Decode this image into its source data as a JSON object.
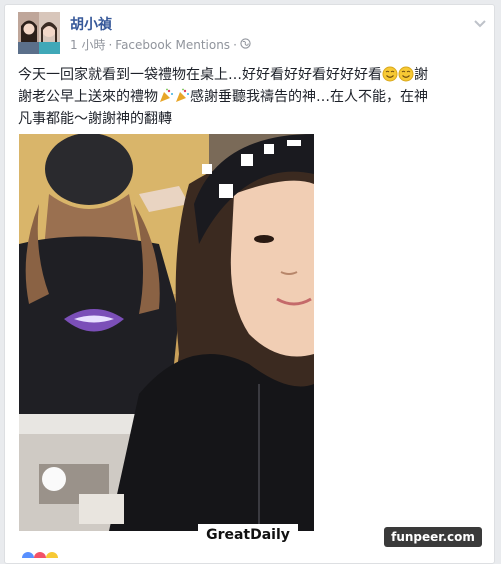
{
  "post": {
    "author": "胡小禎",
    "time": "1 小時",
    "separator": " · ",
    "app": "Facebook Mentions",
    "sep2": " · ",
    "text_part1": "今天一回家就看到一袋禮物在桌上…好好看好好看好好好看",
    "text_part2": "謝\n謝老公早上送來的禮物",
    "text_part3": "感謝垂聽我禱告的神…在人不能，在神\n凡事都能～謝謝神的翻轉"
  },
  "icons": {
    "privacy": "globe-icon",
    "menu": "chevron-down-icon",
    "emoji1": "smile-emoji-icon",
    "emoji2": "smile-emoji-icon",
    "gift": "party-popper-icon"
  },
  "colors": {
    "name": "#365899",
    "meta": "#90949c",
    "text": "#1d2129",
    "bg": "#e9ebee"
  },
  "watermarks": {
    "left": "GreatDaily",
    "right": "funpeer.com"
  }
}
